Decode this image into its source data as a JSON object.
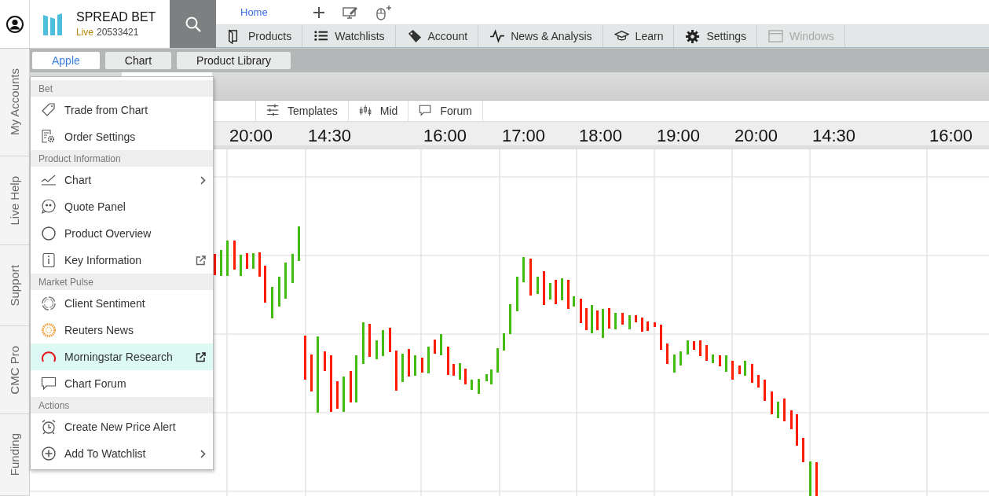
{
  "brand": {
    "title": "SPREAD BET",
    "mode": "Live",
    "account": "20533421"
  },
  "home_link": "Home",
  "nav_tabs": [
    {
      "label": "Products",
      "disabled": false
    },
    {
      "label": "Watchlists",
      "disabled": false
    },
    {
      "label": "Account",
      "disabled": false
    },
    {
      "label": "News & Analysis",
      "disabled": false
    },
    {
      "label": "Learn",
      "disabled": false
    },
    {
      "label": "Settings",
      "disabled": false
    },
    {
      "label": "Windows",
      "disabled": true
    }
  ],
  "side_tabs": [
    "My Accounts",
    "Live Help",
    "Support",
    "CMC Pro",
    "Funding"
  ],
  "doc_tabs": [
    {
      "label": "Apple",
      "selected": true
    },
    {
      "label": "Chart",
      "selected": false
    },
    {
      "label": "Product Library",
      "selected": false
    }
  ],
  "chart_toolbar": [
    "Templates",
    "Mid",
    "Forum"
  ],
  "time_axis": [
    "20:00",
    "14:30",
    "16:00",
    "17:00",
    "18:00",
    "19:00",
    "20:00",
    "14:30",
    "16:00"
  ],
  "context_menu": {
    "sections": [
      {
        "title": "Bet",
        "items": [
          {
            "label": "Trade from Chart",
            "kind": "plain",
            "selected": false
          },
          {
            "label": "Order Settings",
            "kind": "plain",
            "selected": false
          }
        ]
      },
      {
        "title": "Product Information",
        "items": [
          {
            "label": "Chart",
            "kind": "submenu",
            "selected": false
          },
          {
            "label": "Quote Panel",
            "kind": "plain",
            "selected": false
          },
          {
            "label": "Product Overview",
            "kind": "plain",
            "selected": false
          },
          {
            "label": "Key Information",
            "kind": "external",
            "selected": false
          }
        ]
      },
      {
        "title": "Market Pulse",
        "items": [
          {
            "label": "Client Sentiment",
            "kind": "plain",
            "selected": false
          },
          {
            "label": "Reuters News",
            "kind": "plain",
            "selected": false
          },
          {
            "label": "Morningstar Research",
            "kind": "external",
            "selected": true
          },
          {
            "label": "Chart Forum",
            "kind": "plain",
            "selected": false
          }
        ]
      },
      {
        "title": "Actions",
        "items": [
          {
            "label": "Create New Price Alert",
            "kind": "plain",
            "selected": false
          },
          {
            "label": "Add To Watchlist",
            "kind": "submenu",
            "selected": false
          }
        ]
      }
    ]
  }
}
